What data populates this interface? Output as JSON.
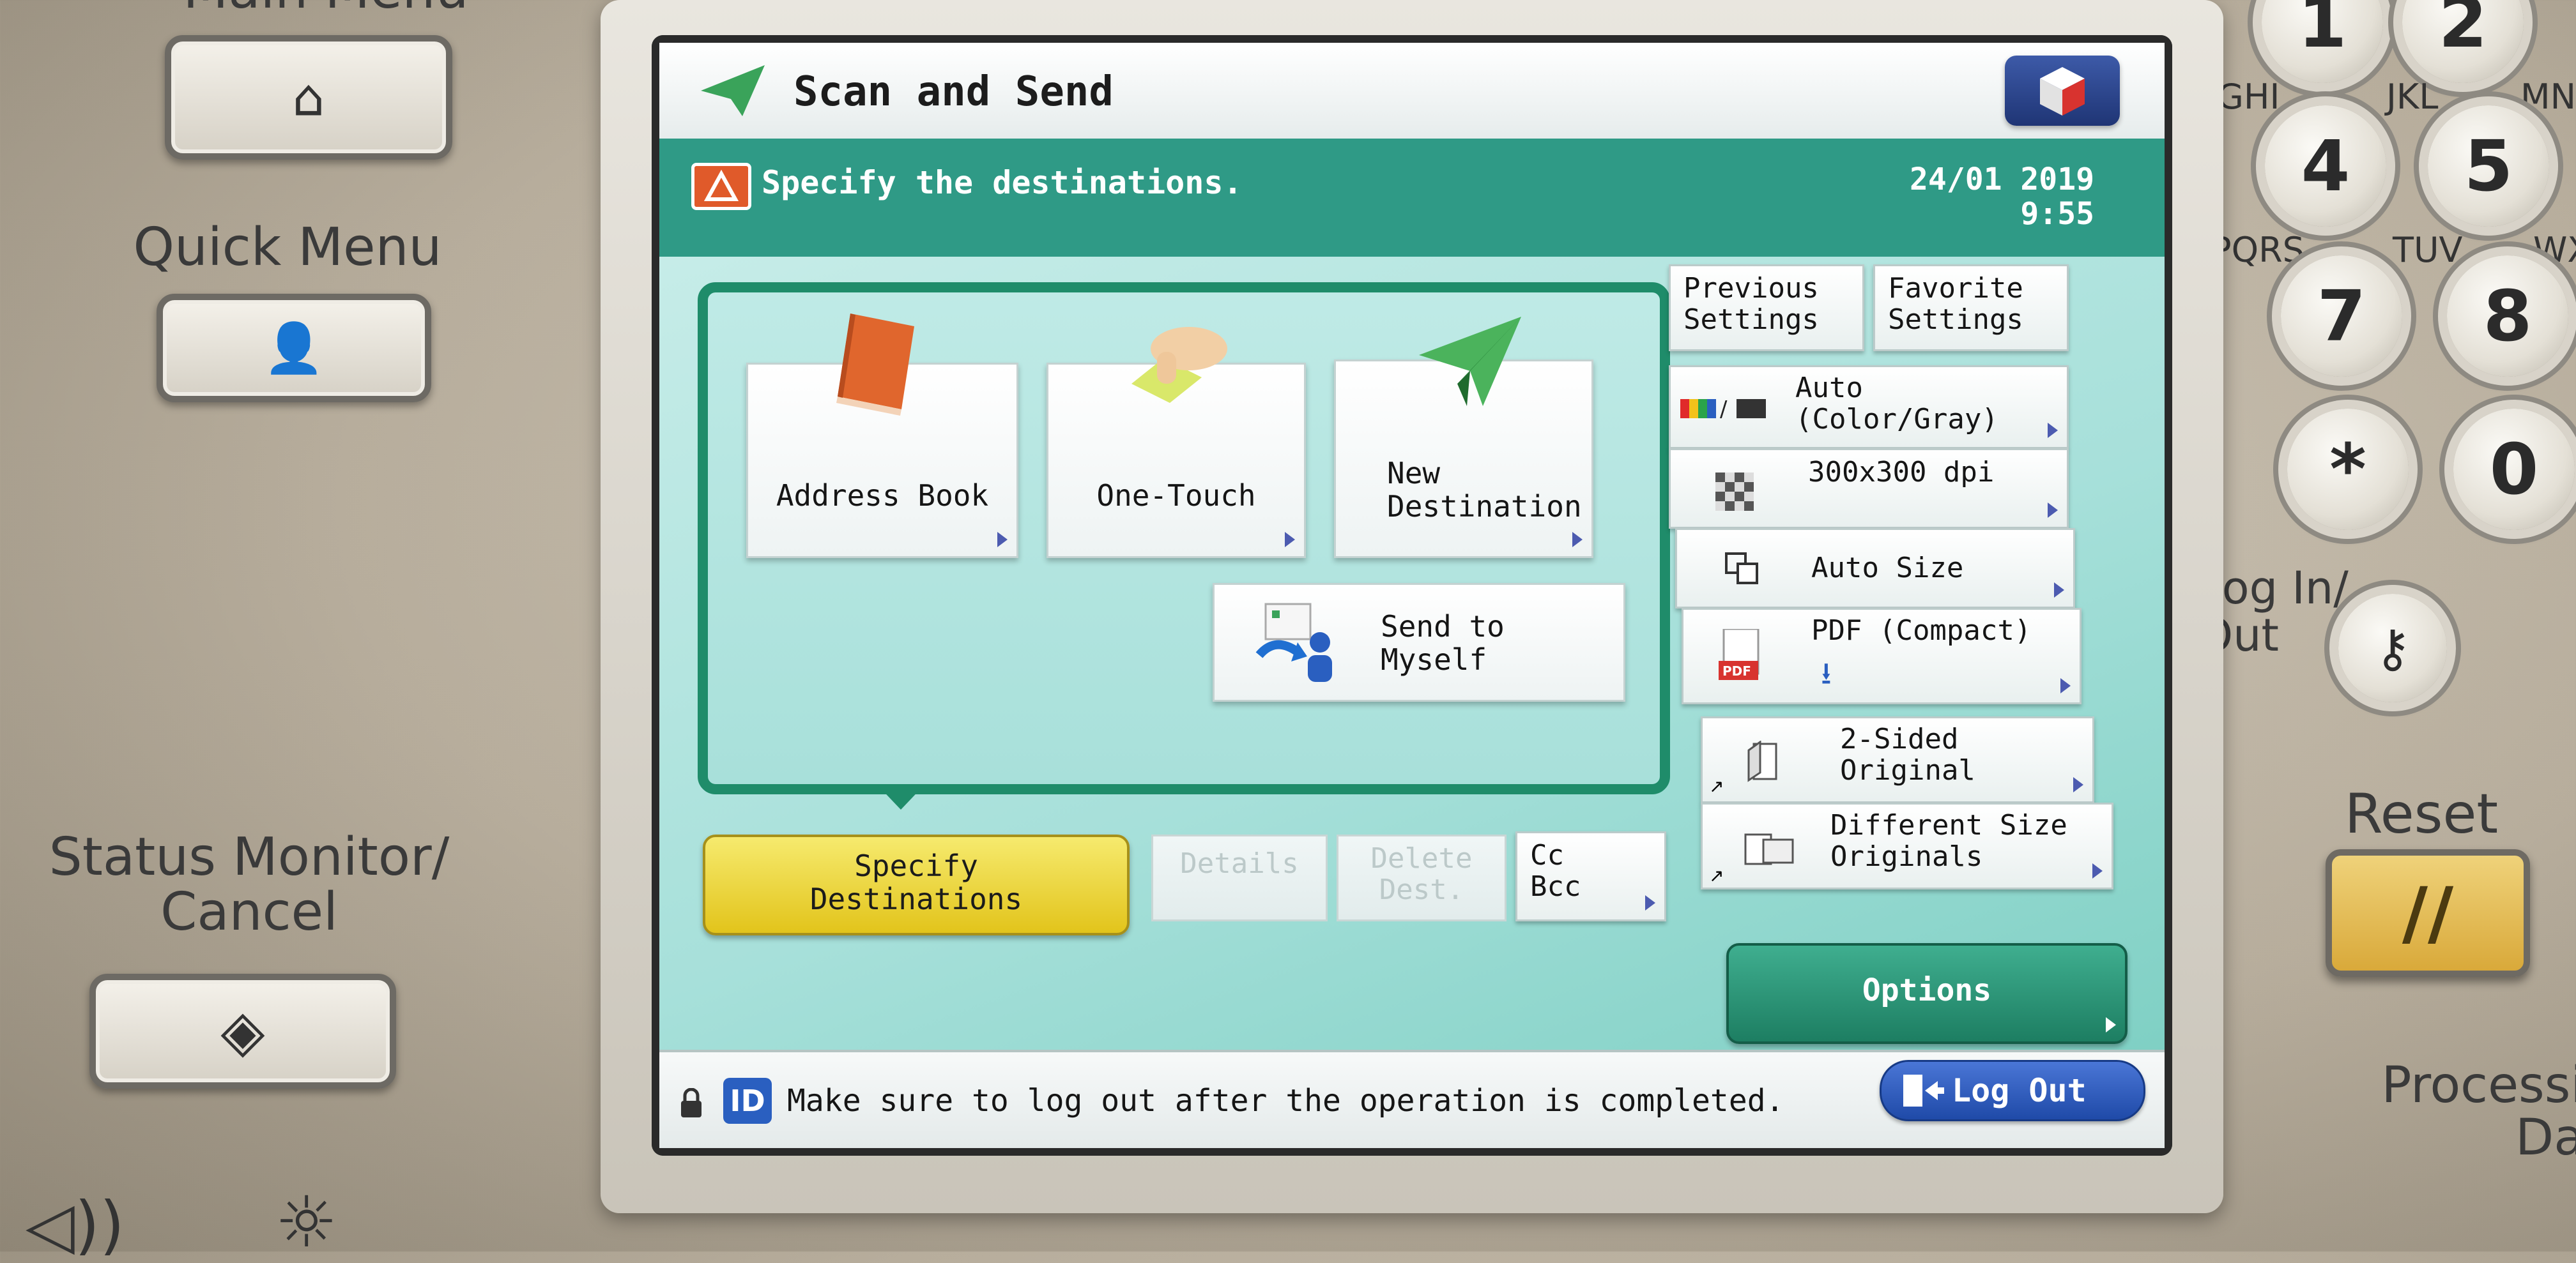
{
  "panel": {
    "main_menu_label": "Main Menu",
    "quick_menu_label": "Quick Menu",
    "status_monitor_label": "Status Monitor/\nCancel",
    "login_label": "Log In/\nOut",
    "reset_label": "Reset",
    "processing_label": "Processi\nDa"
  },
  "keypad": {
    "keys": [
      "1",
      "2",
      "4",
      "5",
      "7",
      "8",
      "*",
      "0"
    ],
    "letters": [
      "GHI",
      "JKL",
      "MN",
      "PQRS",
      "TUV",
      "WX"
    ]
  },
  "screen": {
    "title": "Scan and Send",
    "message": "Specify the destinations.",
    "date": "24/01 2019",
    "time": "9:55",
    "dest_buttons": {
      "address_book": "Address Book",
      "one_touch": "One-Touch",
      "new_destination": "New\nDestination",
      "send_to_myself": "Send to\nMyself"
    },
    "specify_destinations": "Specify\nDestinations",
    "details": "Details",
    "delete_dest": "Delete\nDest.",
    "cc_bcc": "Cc\nBcc",
    "previous_settings": "Previous\nSettings",
    "favorite_settings": "Favorite\nSettings",
    "color_mode": "Auto\n(Color/Gray)",
    "resolution": "300x300 dpi",
    "scan_size": "Auto Size",
    "file_format": "PDF (Compact)",
    "sided": "2-Sided\nOriginal",
    "different_size": "Different Size\nOriginals",
    "options": "Options",
    "status_message": "Make sure to log out after the operation is completed.",
    "id_badge": "ID",
    "logout": "Log Out"
  },
  "colors": {
    "accent_green": "#2f9a86",
    "dest_frame": "#1f8c6a",
    "yellow_button": "#e2c41b",
    "logout_blue": "#1f4aa8"
  }
}
